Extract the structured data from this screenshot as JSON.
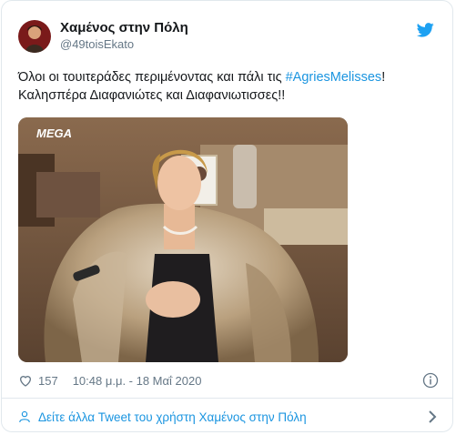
{
  "user": {
    "display_name": "Χαμένος στην Πόλη",
    "handle": "@49toisEkato"
  },
  "tweet": {
    "text_before": "Όλοι οι τουιτεράδες περιμένοντας και πάλι τις ",
    "hashtag": "#AgriesMelisses",
    "text_after": "! Καλησπέρα Διαφανιώτες και Διαφανιωτισσες!!"
  },
  "media": {
    "watermark": "MEGA"
  },
  "meta": {
    "like_count": "157",
    "time": "10:48 μ.μ. - 18 Μαΐ 2020"
  },
  "footer": {
    "link_text": "Δείτε άλλα Tweet του χρήστη Χαμένος στην Πόλη"
  },
  "icons": {
    "brand": "twitter-bird-icon",
    "like": "heart-icon",
    "info": "info-icon",
    "person": "person-icon",
    "chevron": "chevron-right-icon"
  },
  "colors": {
    "link": "#1b95e0",
    "muted": "#657786",
    "border": "#e1e8ed",
    "text": "#14171a"
  }
}
